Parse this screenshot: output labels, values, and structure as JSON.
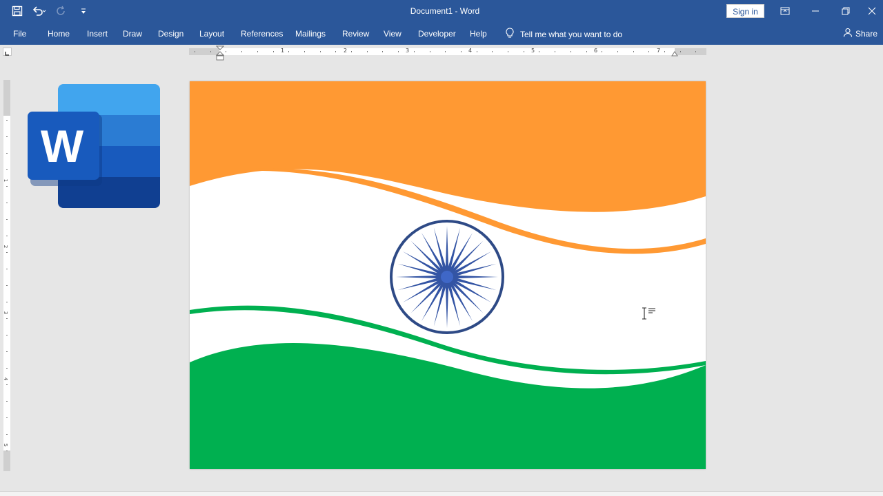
{
  "window": {
    "title": "Document1  -  Word",
    "sign_in_label": "Sign in"
  },
  "ribbon": {
    "tabs": [
      "File",
      "Home",
      "Insert",
      "Draw",
      "Design",
      "Layout",
      "References",
      "Mailings",
      "Review",
      "View",
      "Developer",
      "Help"
    ],
    "tell_me": "Tell me what you want to do",
    "share_label": "Share"
  },
  "ruler": {
    "numbers": [
      "1",
      "2",
      "3",
      "4",
      "5",
      "6",
      "7"
    ],
    "vertical_numbers": [
      "1",
      "2",
      "3",
      "4",
      "5"
    ]
  },
  "colors": {
    "ribbon": "#2b579a",
    "saffron": "#ff9933",
    "green": "#00b050",
    "chakra": "#2e4a86"
  },
  "icons": {
    "save": "save-icon",
    "undo": "undo-icon",
    "redo": "redo-icon",
    "customize": "customize-qat-icon",
    "ribbon_options": "ribbon-display-options-icon",
    "minimize": "minimize-icon",
    "restore": "restore-icon",
    "close": "close-icon",
    "lightbulb": "lightbulb-icon",
    "person": "person-icon",
    "logo": "word-logo-icon",
    "chakra": "ashoka-chakra-icon",
    "cursor": "text-cursor-icon"
  },
  "logo_letter": "W"
}
